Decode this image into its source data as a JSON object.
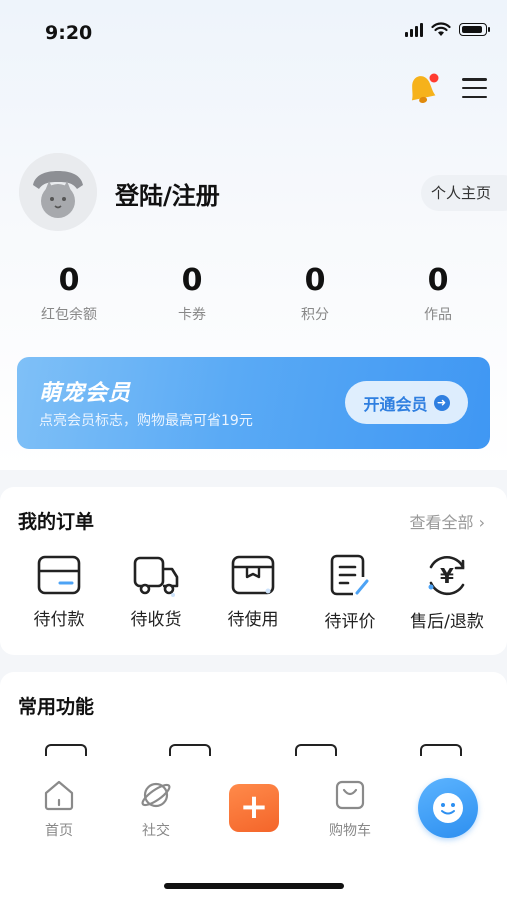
{
  "status_bar": {
    "time": "9:20"
  },
  "header": {
    "notification_icon": "bell-icon",
    "menu_icon": "menu-icon",
    "notification_dot_color": "#ff3b30"
  },
  "profile": {
    "login_label": "登陆/注册",
    "home_button": "个人主页"
  },
  "stats": [
    {
      "value": "0",
      "label": "红包余额"
    },
    {
      "value": "0",
      "label": "卡券"
    },
    {
      "value": "0",
      "label": "积分"
    },
    {
      "value": "0",
      "label": "作品"
    }
  ],
  "vip": {
    "title": "萌宠会员",
    "subtitle": "点亮会员标志，购物最高可省19元",
    "button": "开通会员",
    "accent": "#3f97f3"
  },
  "orders": {
    "title": "我的订单",
    "view_all": "查看全部 ›",
    "items": [
      {
        "label": "待付款",
        "icon": "wallet-icon"
      },
      {
        "label": "待收货",
        "icon": "delivery-truck-icon"
      },
      {
        "label": "待使用",
        "icon": "package-box-icon"
      },
      {
        "label": "待评价",
        "icon": "review-document-icon"
      },
      {
        "label": "售后/退款",
        "icon": "yen-refund-icon"
      }
    ]
  },
  "functions": {
    "title": "常用功能"
  },
  "tabbar": {
    "items": [
      {
        "label": "首页",
        "icon": "home-icon"
      },
      {
        "label": "社交",
        "icon": "planet-icon"
      },
      {
        "label": "",
        "icon": "plus-icon"
      },
      {
        "label": "购物车",
        "icon": "shopping-bag-icon"
      },
      {
        "label": "",
        "icon": "smile-face-icon"
      }
    ],
    "accent_plus": "#f4652a",
    "accent_smile": "#2d8ff0"
  }
}
